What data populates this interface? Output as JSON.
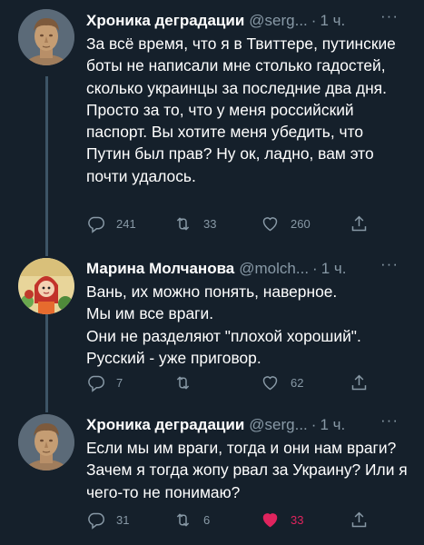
{
  "tweets": [
    {
      "name": "Хроника деградации",
      "handle": "@serg...",
      "dot": "·",
      "time": "1 ч.",
      "more": "···",
      "text": [
        "За всё время, что я в Твиттере, путинские боты не написали мне столько гадостей, сколько украинцы за последние два дня. Просто за то, что у меня российский паспорт. Вы хотите меня убедить, что Путин был прав? Ну ок, ладно, вам это почти удалось."
      ],
      "replies": "241",
      "retweets": "33",
      "likes": "260",
      "liked": false,
      "avatar": "bust-statue"
    },
    {
      "name": "Марина Молчанова",
      "handle": "@molch...",
      "dot": "·",
      "time": "1 ч.",
      "more": "···",
      "text": [
        "Вань, их можно понять, наверное.",
        "Мы им все враги.",
        "Они не разделяют \"плохой хороший\".",
        "Русский - уже приговор."
      ],
      "replies": "7",
      "retweets": "",
      "likes": "62",
      "liked": false,
      "avatar": "cartoon-girl"
    },
    {
      "name": "Хроника деградации",
      "handle": "@serg...",
      "dot": "·",
      "time": "1 ч.",
      "more": "···",
      "text": [
        "Если мы им враги, тогда и они нам враги? Зачем я тогда жопу рвал за Украину? Или я чего-то не понимаю?"
      ],
      "replies": "31",
      "retweets": "6",
      "likes": "33",
      "liked": true,
      "avatar": "bust-statue"
    }
  ],
  "colors": {
    "background": "#15202b",
    "secondary_text": "#8899a6",
    "like_active": "#e0245e",
    "thread_line": "#3d5466"
  }
}
